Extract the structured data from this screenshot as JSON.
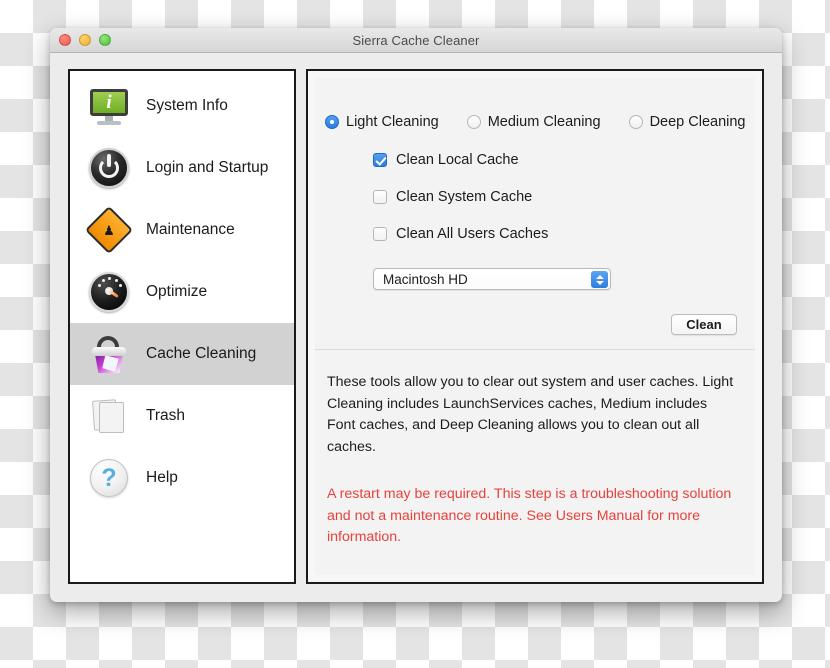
{
  "window": {
    "title": "Sierra Cache Cleaner",
    "traffic_lights": [
      "close",
      "minimize",
      "zoom"
    ]
  },
  "sidebar": {
    "items": [
      {
        "label": "System Info",
        "icon": "monitor-info-icon",
        "selected": false
      },
      {
        "label": "Login and Startup",
        "icon": "power-button-icon",
        "selected": false
      },
      {
        "label": "Maintenance",
        "icon": "construction-sign-icon",
        "selected": false
      },
      {
        "label": "Optimize",
        "icon": "gauge-icon",
        "selected": false
      },
      {
        "label": "Cache Cleaning",
        "icon": "cache-bucket-icon",
        "selected": true
      },
      {
        "label": "Trash",
        "icon": "trash-icon",
        "selected": false
      },
      {
        "label": "Help",
        "icon": "question-mark-icon",
        "selected": false
      }
    ]
  },
  "main": {
    "cleaning_level": {
      "selected": "Light Cleaning",
      "options": [
        {
          "label": "Light Cleaning",
          "selected": true
        },
        {
          "label": "Medium Cleaning",
          "selected": false
        },
        {
          "label": "Deep Cleaning",
          "selected": false
        }
      ]
    },
    "checkboxes": [
      {
        "label": "Clean Local Cache",
        "checked": true
      },
      {
        "label": "Clean System Cache",
        "checked": false
      },
      {
        "label": "Clean All Users Caches",
        "checked": false
      }
    ],
    "volume_select": {
      "value": "Macintosh HD",
      "options": [
        "Macintosh HD"
      ]
    },
    "clean_button": "Clean",
    "description": "These tools allow you to clear out system and user caches.  Light Cleaning includes LaunchServices caches, Medium includes Font caches, and Deep Cleaning allows you to clean out all caches.",
    "warning": "A restart may be required.  This step is a troubleshooting solution and not a maintenance routine.  See Users Manual for more information."
  },
  "colors": {
    "accent_blue": "#2b7de0",
    "warning_red": "#e8413c",
    "selection_gray": "#d2d2d2"
  }
}
